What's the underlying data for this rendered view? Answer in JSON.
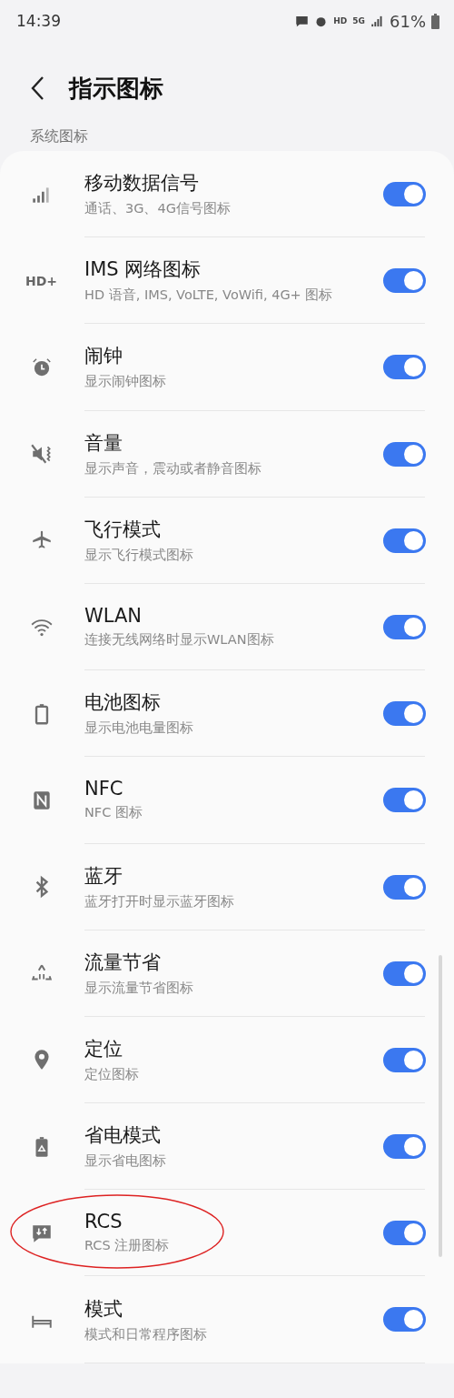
{
  "status_bar": {
    "time": "14:39",
    "hd": "HD",
    "network": "5G",
    "battery": "61%"
  },
  "header": {
    "title": "指示图标"
  },
  "section": {
    "label": "系统图标"
  },
  "items": [
    {
      "title": "移动数据信号",
      "subtitle": "通话、3G、4G信号图标",
      "on": true,
      "highlighted": false
    },
    {
      "title": "IMS 网络图标",
      "subtitle": "HD 语音, IMS, VoLTE, VoWifi, 4G+ 图标",
      "icon_text": "HD+",
      "on": true,
      "highlighted": false
    },
    {
      "title": "闹钟",
      "subtitle": "显示闹钟图标",
      "on": true,
      "highlighted": false
    },
    {
      "title": "音量",
      "subtitle": "显示声音，震动或者静音图标",
      "on": true,
      "highlighted": false
    },
    {
      "title": "飞行模式",
      "subtitle": "显示飞行模式图标",
      "on": true,
      "highlighted": false
    },
    {
      "title": "WLAN",
      "subtitle": "连接无线网络时显示WLAN图标",
      "on": true,
      "highlighted": false
    },
    {
      "title": "电池图标",
      "subtitle": "显示电池电量图标",
      "on": true,
      "highlighted": false
    },
    {
      "title": "NFC",
      "subtitle": "NFC 图标",
      "on": true,
      "highlighted": false
    },
    {
      "title": "蓝牙",
      "subtitle": "蓝牙打开时显示蓝牙图标",
      "on": true,
      "highlighted": false
    },
    {
      "title": "流量节省",
      "subtitle": "显示流量节省图标",
      "on": true,
      "highlighted": false
    },
    {
      "title": "定位",
      "subtitle": "定位图标",
      "on": true,
      "highlighted": false
    },
    {
      "title": "省电模式",
      "subtitle": "显示省电图标",
      "on": true,
      "highlighted": false
    },
    {
      "title": "RCS",
      "subtitle": "RCS 注册图标",
      "on": true,
      "highlighted": true
    },
    {
      "title": "模式",
      "subtitle": "模式和日常程序图标",
      "on": true,
      "highlighted": false
    }
  ]
}
